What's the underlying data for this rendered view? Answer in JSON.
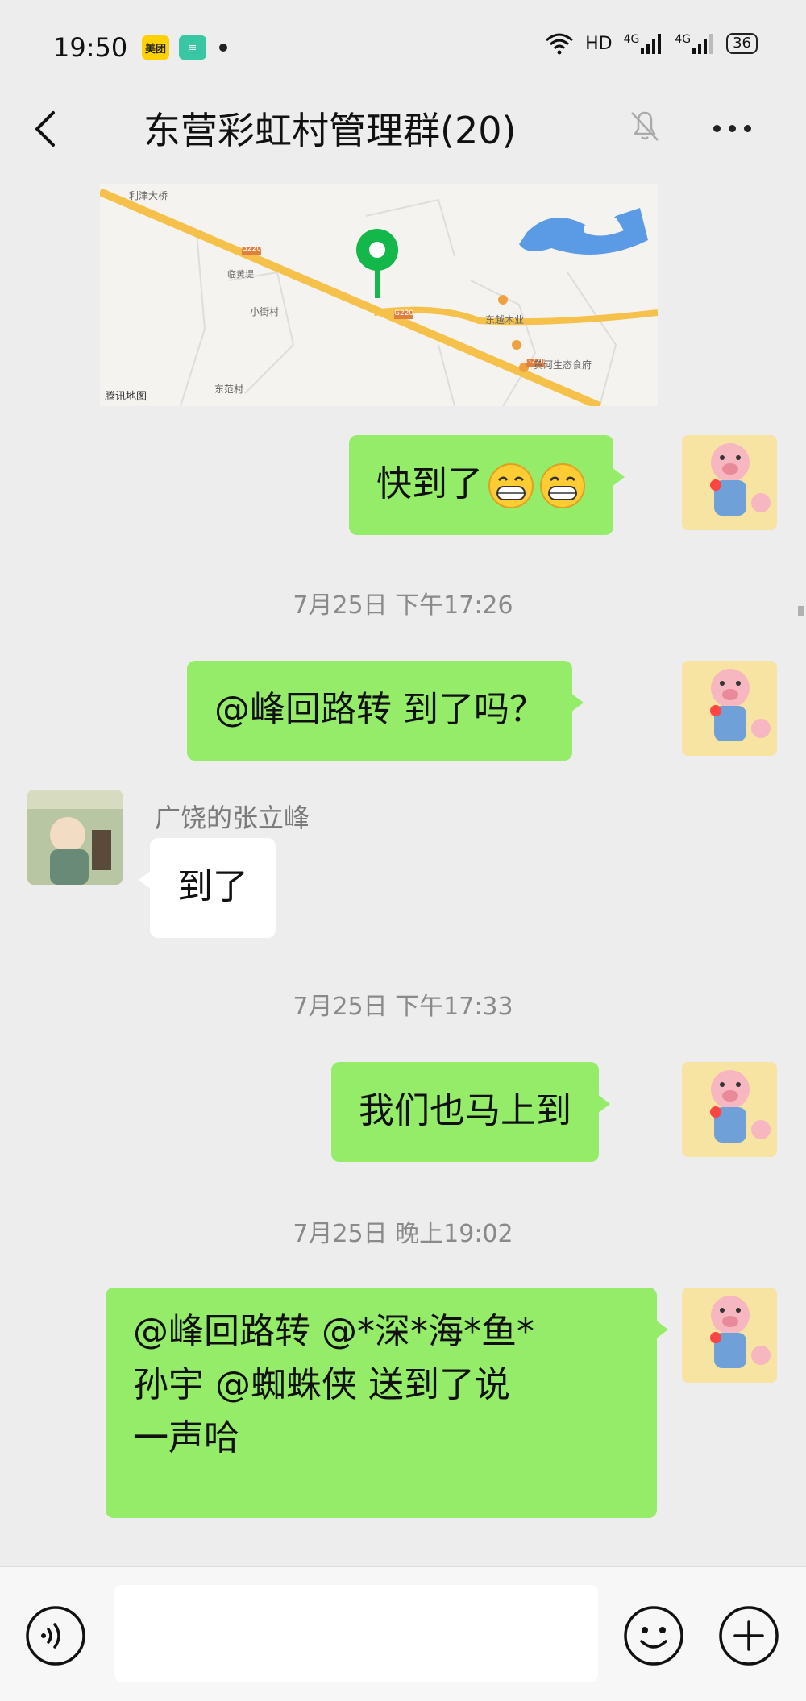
{
  "status_bar": {
    "time": "19:50",
    "app_badges": [
      "美团",
      "≡"
    ],
    "network": "HD",
    "signal1": "4G",
    "signal2": "4G",
    "battery": "36"
  },
  "header": {
    "title": "东营彩虹村管理群(20)"
  },
  "map": {
    "labels": [
      "利津大桥",
      "G220",
      "小街村",
      "临黄堤",
      "G220",
      "东越木业",
      "黄河生态食府",
      "G220",
      "东范村"
    ],
    "brand": "腾讯地图",
    "colors": {
      "road": "#f5c14a",
      "water": "#5b9be6",
      "pin": "#14b84a"
    }
  },
  "messages": [
    {
      "id": "m1",
      "side": "right",
      "text": "快到了",
      "emoji_count": 2
    },
    {
      "id": "t1",
      "type": "timestamp",
      "text": "7月25日 下午17:26"
    },
    {
      "id": "m2",
      "side": "right",
      "text": "@峰回路转  到了吗？"
    },
    {
      "id": "m3",
      "side": "left",
      "sender": "广饶的张立峰",
      "text": "到了"
    },
    {
      "id": "t2",
      "type": "timestamp",
      "text": "7月25日 下午17:33"
    },
    {
      "id": "m4",
      "side": "right",
      "text": "我们也马上到"
    },
    {
      "id": "t3",
      "type": "timestamp",
      "text": "7月25日 晚上19:02"
    },
    {
      "id": "m5",
      "side": "right",
      "lines": [
        "@峰回路转  @*深*海*鱼*",
        "孙宇  @蜘蛛侠  送到了说",
        "一声哈"
      ]
    }
  ],
  "input_bar": {
    "placeholder": ""
  },
  "colors": {
    "bubble_mine": "#95ec69",
    "bubble_other": "#ffffff",
    "background": "#ededed"
  }
}
